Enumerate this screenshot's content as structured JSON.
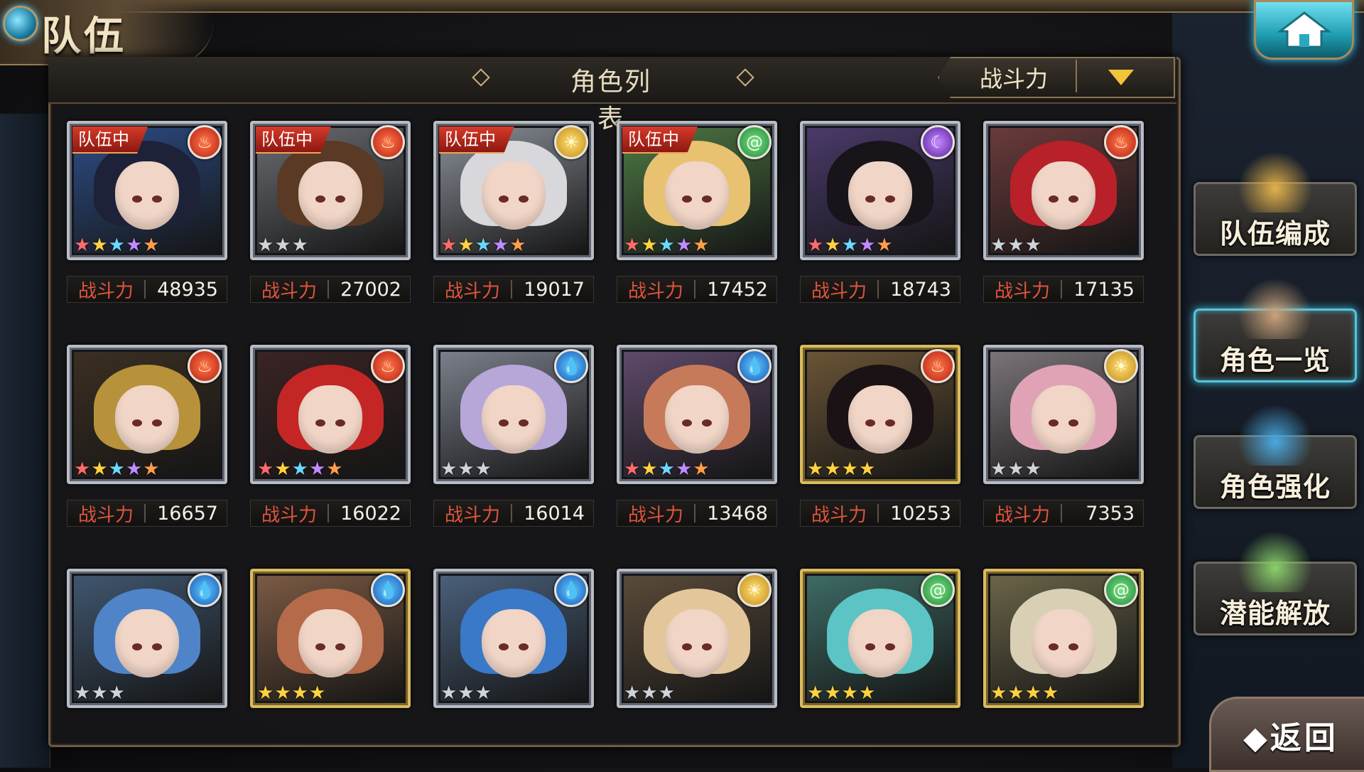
{
  "header": {
    "title": "队伍",
    "home_icon": "home-icon"
  },
  "list": {
    "title": "角色列表",
    "sort_label": "战斗力",
    "power_label": "战斗力",
    "team_badge": "队伍中"
  },
  "rows": [
    [
      {
        "in_team": true,
        "element": "fire",
        "stars": 5,
        "star_color": "rainbow",
        "frame": "silver",
        "power": "48935",
        "hair": "#1d2238",
        "bg": "#2d4d86"
      },
      {
        "in_team": true,
        "element": "fire",
        "stars": 3,
        "star_color": "silver",
        "frame": "silver",
        "power": "27002",
        "hair": "#5a3a24",
        "bg": "#6a6d72"
      },
      {
        "in_team": true,
        "element": "light",
        "stars": 5,
        "star_color": "rainbow",
        "frame": "silver",
        "power": "19017",
        "hair": "#d8d8dc",
        "bg": "#8a8f98"
      },
      {
        "in_team": true,
        "element": "wind",
        "stars": 5,
        "star_color": "rainbow",
        "frame": "silver",
        "power": "17452",
        "hair": "#e8c270",
        "bg": "#4f7a45"
      },
      {
        "in_team": false,
        "element": "dark",
        "stars": 5,
        "star_color": "rainbow",
        "frame": "silver",
        "power": "18743",
        "hair": "#17141a",
        "bg": "#4a3a6a"
      },
      {
        "in_team": false,
        "element": "fire",
        "stars": 3,
        "star_color": "silver",
        "frame": "silver",
        "power": "17135",
        "hair": "#b8202a",
        "bg": "#6a3b3b"
      }
    ],
    [
      {
        "in_team": false,
        "element": "fire",
        "stars": 5,
        "star_color": "rainbow",
        "frame": "silver",
        "power": "16657",
        "hair": "#b7923a",
        "bg": "#3b2f23"
      },
      {
        "in_team": false,
        "element": "fire",
        "stars": 5,
        "star_color": "rainbow",
        "frame": "silver",
        "power": "16022",
        "hair": "#c42626",
        "bg": "#3a2424"
      },
      {
        "in_team": false,
        "element": "water",
        "stars": 3,
        "star_color": "silver",
        "frame": "silver",
        "power": "16014",
        "hair": "#b7a6d8",
        "bg": "#7a7f8a"
      },
      {
        "in_team": false,
        "element": "water",
        "stars": 5,
        "star_color": "rainbow",
        "frame": "silver",
        "power": "13468",
        "hair": "#c77a5a",
        "bg": "#5e4a6a"
      },
      {
        "in_team": false,
        "element": "fire",
        "stars": 4,
        "star_color": "gold",
        "frame": "gold",
        "power": "10253",
        "hair": "#1a1214",
        "bg": "#6a5436"
      },
      {
        "in_team": false,
        "element": "light",
        "stars": 3,
        "star_color": "silver",
        "frame": "silver",
        "power": "7353",
        "hair": "#e0a3b6",
        "bg": "#7a7478"
      }
    ],
    [
      {
        "in_team": false,
        "element": "water",
        "stars": 3,
        "star_color": "silver",
        "frame": "silver",
        "hair": "#4f84c8",
        "bg": "#40566e"
      },
      {
        "in_team": false,
        "element": "water",
        "stars": 4,
        "star_color": "gold",
        "frame": "gold",
        "hair": "#b56a4a",
        "bg": "#7a5a44"
      },
      {
        "in_team": false,
        "element": "water",
        "stars": 3,
        "star_color": "silver",
        "frame": "silver",
        "hair": "#3a78c8",
        "bg": "#4a5f7a"
      },
      {
        "in_team": false,
        "element": "light",
        "stars": 3,
        "star_color": "silver",
        "frame": "silver",
        "hair": "#e3c79a",
        "bg": "#5a4a3a"
      },
      {
        "in_team": false,
        "element": "wind",
        "stars": 4,
        "star_color": "gold",
        "frame": "gold",
        "hair": "#5cc4c4",
        "bg": "#3e6a64"
      },
      {
        "in_team": false,
        "element": "wind",
        "stars": 4,
        "star_color": "gold",
        "frame": "gold",
        "hair": "#d8cfb4",
        "bg": "#6a6448"
      }
    ]
  ],
  "side_menu": [
    {
      "label": "队伍编成",
      "icon": "party-icon",
      "active": false
    },
    {
      "label": "角色一览",
      "icon": "book-icon",
      "active": true
    },
    {
      "label": "角色强化",
      "icon": "enhance-icon",
      "active": false
    },
    {
      "label": "潜能解放",
      "icon": "potential-icon",
      "active": false
    }
  ],
  "back": {
    "label": "返回",
    "icon": "back-arrow-icon"
  },
  "colors": {
    "accent_red": "#e0553c",
    "team_badge": "#d63a2a",
    "active_glow": "#39b6d6",
    "gold": "#ffd23f"
  }
}
